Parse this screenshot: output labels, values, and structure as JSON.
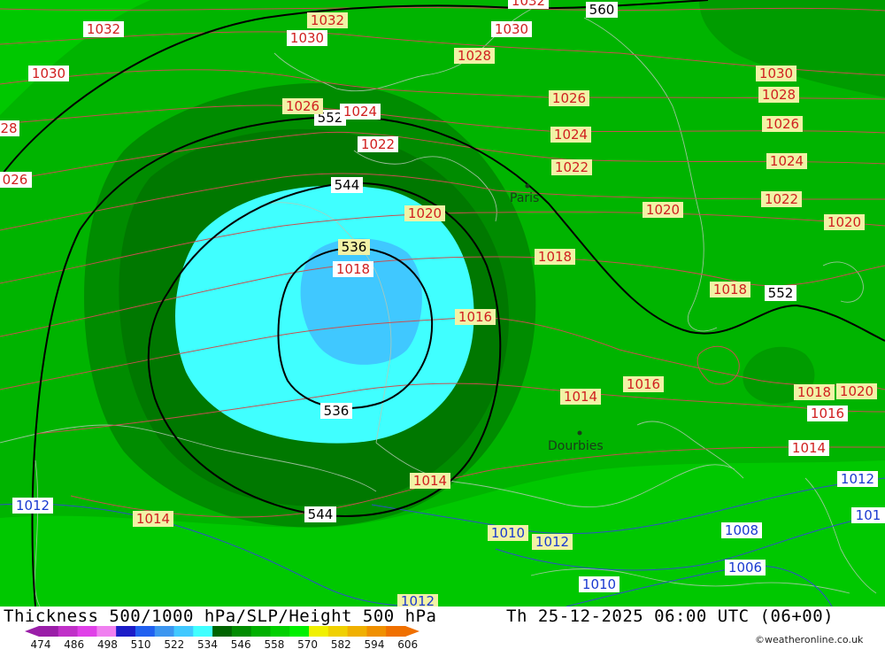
{
  "map": {
    "title": "Thickness 500/1000 hPa/SLP/Height 500 hPa",
    "valid_time": "Th 25-12-2025 06:00 UTC (06+00)",
    "copyright": "©weatheronline.co.uk",
    "cities": [
      "Paris",
      "Dourbies"
    ],
    "pressure_labels": {
      "p1032": "1032",
      "p1030": "1030",
      "p1028": "1028",
      "p1026": "1026",
      "p1024": "1024",
      "p1022": "1022",
      "p1020": "1020",
      "p1018": "1018",
      "p1016": "1016",
      "p1014": "1014",
      "p1012": "1012",
      "p1010": "1010",
      "p1008": "1008",
      "p1006": "1006",
      "p28_cut": "28",
      "p026_cut": "026",
      "p101_cut": "101"
    },
    "height_labels": {
      "h536": "536",
      "h544": "544",
      "h552": "552",
      "h560": "560"
    },
    "legend": {
      "ticks": [
        "474",
        "486",
        "498",
        "510",
        "522",
        "534",
        "546",
        "558",
        "570",
        "582",
        "594",
        "606"
      ],
      "colors": [
        "#9a1ea8",
        "#c030c8",
        "#e040e8",
        "#f080f0",
        "#1c1cc8",
        "#2060f0",
        "#3c96f0",
        "#40c8ff",
        "#40ffff",
        "#006400",
        "#008c00",
        "#00b000",
        "#00d000",
        "#00f000",
        "#f0f000",
        "#f0d000",
        "#f0b000",
        "#f09000",
        "#f07000"
      ]
    },
    "colors": {
      "pressure_label_fill": "#f2f2a6",
      "pressure_line": "#c85050",
      "pressure_text": "#d02020",
      "low_pressure_text": "#1a3ad0",
      "height_line": "#000000"
    }
  }
}
